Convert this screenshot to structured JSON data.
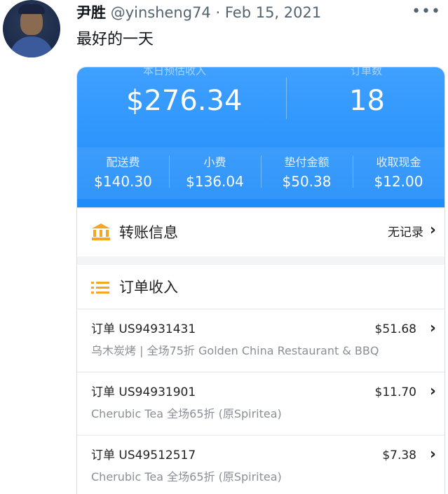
{
  "tweet": {
    "display_name": "尹胜",
    "handle": "@yinsheng74",
    "separator": "·",
    "date": "Feb 15, 2021",
    "text": "最好的一天",
    "more_icon": "more-dots-icon"
  },
  "screenshot": {
    "top_labels": {
      "left_cut": "本日预估收入",
      "right_cut": "订单数"
    },
    "total_income": "$276.34",
    "order_count": "18",
    "stats": [
      {
        "label": "配送费",
        "value": "$140.30"
      },
      {
        "label": "小费",
        "value": "$136.04"
      },
      {
        "label": "垫付金额",
        "value": "$50.38"
      },
      {
        "label": "收取现金",
        "value": "$12.00"
      }
    ],
    "transfer": {
      "icon": "bank-icon",
      "title": "转账信息",
      "status": "无记录"
    },
    "orders_header": {
      "icon": "list-icon",
      "title": "订单收入"
    },
    "orders": [
      {
        "id": "订单 US94931431",
        "amount": "$51.68",
        "desc": "乌木炭烤 | 全场75折 Golden China Restaurant & BBQ"
      },
      {
        "id": "订单 US94931901",
        "amount": "$11.70",
        "desc": "Cherubic Tea 全场65折 (原Spiritea)"
      },
      {
        "id": "订单 US49512517",
        "amount": "$7.38",
        "desc": "Cherubic Tea 全场65折 (原Spiritea)"
      }
    ],
    "colors": {
      "header_blue": "#1e8cf9",
      "icon_orange": "#f5a623"
    }
  }
}
